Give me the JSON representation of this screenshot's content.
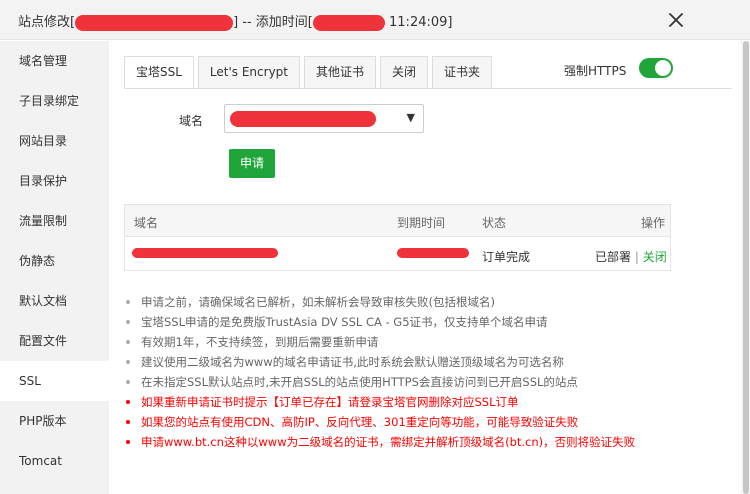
{
  "title": {
    "prefix": "站点修改[",
    "middle": "] -- 添加时间[",
    "time": "11:24:09]"
  },
  "sidebar": {
    "items": [
      {
        "label": "域名管理"
      },
      {
        "label": "子目录绑定"
      },
      {
        "label": "网站目录"
      },
      {
        "label": "目录保护"
      },
      {
        "label": "流量限制"
      },
      {
        "label": "伪静态"
      },
      {
        "label": "默认文档"
      },
      {
        "label": "配置文件"
      },
      {
        "label": "SSL"
      },
      {
        "label": "PHP版本"
      },
      {
        "label": "Tomcat"
      }
    ],
    "active_index": 8
  },
  "tabs": [
    {
      "label": "宝塔SSL"
    },
    {
      "label": "Let's Encrypt"
    },
    {
      "label": "其他证书"
    },
    {
      "label": "关闭"
    },
    {
      "label": "证书夹"
    }
  ],
  "force_https": {
    "label": "强制HTTPS",
    "enabled": true
  },
  "form": {
    "domain_label": "域名",
    "apply_label": "申请",
    "caret": "▼"
  },
  "table": {
    "headers": {
      "domain": "域名",
      "expiry": "到期时间",
      "status": "状态",
      "action": "操作"
    },
    "row": {
      "status": "订单完成",
      "deployed": "已部署",
      "sep": "|",
      "close": "关闭"
    }
  },
  "notes": [
    {
      "text": "申请之前，请确保域名已解析，如未解析会导致审核失败(包括根域名)",
      "red": false
    },
    {
      "text": "宝塔SSL申请的是免费版TrustAsia DV SSL CA - G5证书，仅支持单个域名申请",
      "red": false
    },
    {
      "text": "有效期1年，不支持续签，到期后需要重新申请",
      "red": false
    },
    {
      "text": "建议使用二级域名为www的域名申请证书,此时系统会默认赠送顶级域名为可选名称",
      "red": false
    },
    {
      "text": "在未指定SSL默认站点时,未开启SSL的站点使用HTTPS会直接访问到已开启SSL的站点",
      "red": false
    },
    {
      "text": "如果重新申请证书时提示【订单已存在】请登录宝塔官网删除对应SSL订单",
      "red": true
    },
    {
      "text": "如果您的站点有使用CDN、高防IP、反向代理、301重定向等功能，可能导致验证失败",
      "red": true
    },
    {
      "text": "申请www.bt.cn这种以www为二级域名的证书，需绑定并解析顶级域名(bt.cn)，否则将验证失败",
      "red": true
    }
  ],
  "colors": {
    "accent": "#20a53a",
    "redact": "#f0323a",
    "warning": "#ff0000"
  },
  "icons": {
    "close": "close-icon",
    "caret": "caret-down-icon"
  }
}
